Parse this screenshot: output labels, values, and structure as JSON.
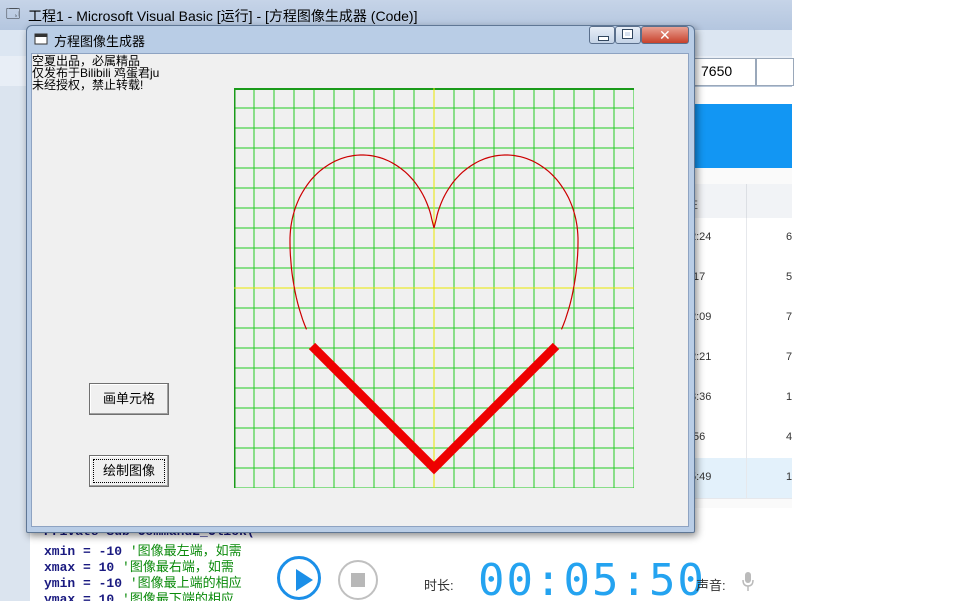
{
  "ide": {
    "title": "工程1 - Microsoft Visual Basic [运行] - [方程图像生成器 (Code)]",
    "counter": "7650"
  },
  "recording_table": {
    "header_label": "E",
    "rows": [
      {
        "time": "2:24",
        "count": "6"
      },
      {
        "time": ":17",
        "count": "5"
      },
      {
        "time": "2:09",
        "count": "7"
      },
      {
        "time": "2:21",
        "count": "7"
      },
      {
        "time": "3:36",
        "count": "1"
      },
      {
        "time": ":56",
        "count": "4"
      },
      {
        "time": "5:49",
        "count": "1"
      }
    ],
    "selected_row": 6
  },
  "code": {
    "lines": [
      {
        "kw": "Private Sub Command2_Click(",
        "cm": ""
      },
      {
        "kw": "xmin = -10 ",
        "cm": "'图像最左端，如需"
      },
      {
        "kw": "xmax = 10 ",
        "cm": "'图像最右端，如需"
      },
      {
        "kw": "ymin = -10 ",
        "cm": "'图像最上端的相应"
      },
      {
        "kw": "ymax = 10 ",
        "cm": "'图像最下端的相应"
      }
    ]
  },
  "player": {
    "duration_label": "时长:",
    "duration_value": "00:05:50",
    "volume_label": "声音:",
    "accent_color": "#1b8fe8"
  },
  "app": {
    "title": "方程图像生成器",
    "info_lines": [
      "空夏出品，必属精品",
      "仅发布于Bilibili 鸡蛋君ju",
      "未经授权，禁止转载!"
    ],
    "grid_button_label": "画单元格",
    "draw_button_label": "绘制图像"
  },
  "plot": {
    "x_range": [
      -10,
      10
    ],
    "y_range": [
      -10,
      10
    ],
    "grid_divisions": 20,
    "grid_color": "#22cc22",
    "axis_color": "#e8e800",
    "curve_color": "#cc0000",
    "thick_curve_color": "#ee0000",
    "heart_top_lobe_height": 4.25,
    "heart_notch_y": 3.0,
    "heart_half_width": 7.2,
    "heart_bottom_y": -9.0,
    "v_start_y": -2.9
  }
}
